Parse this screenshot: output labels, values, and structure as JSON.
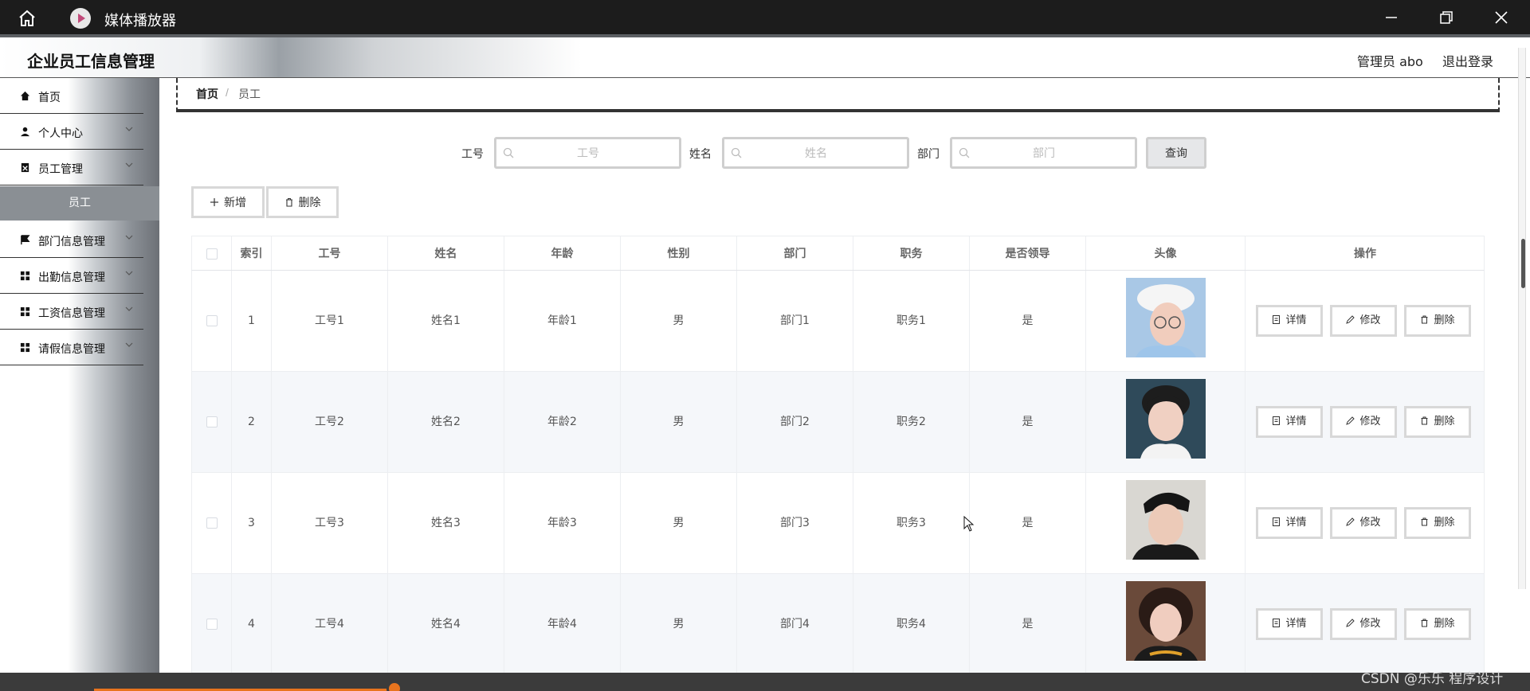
{
  "window": {
    "title": "媒体播放器"
  },
  "app": {
    "brand": "企业员工信息管理",
    "admin_label": "管理员 abo",
    "logout": "退出登录"
  },
  "sidebar": {
    "items": [
      {
        "label": "首页",
        "icon": "home-icon"
      },
      {
        "label": "个人中心",
        "icon": "user-icon"
      },
      {
        "label": "员工管理",
        "icon": "clipboard-icon"
      },
      {
        "label": "部门信息管理",
        "icon": "flag-icon"
      },
      {
        "label": "出勤信息管理",
        "icon": "grid-icon"
      },
      {
        "label": "工资信息管理",
        "icon": "grid-icon"
      },
      {
        "label": "请假信息管理",
        "icon": "grid-icon"
      }
    ],
    "active_sub": "员工"
  },
  "breadcrumb": {
    "home": "首页",
    "separator": "/",
    "current": "员工"
  },
  "search": {
    "id_label": "工号",
    "id_placeholder": "工号",
    "name_label": "姓名",
    "name_placeholder": "姓名",
    "dept_label": "部门",
    "dept_placeholder": "部门",
    "query_button": "查询"
  },
  "actions": {
    "add": "新增",
    "delete": "删除"
  },
  "table": {
    "columns": [
      "索引",
      "工号",
      "姓名",
      "年龄",
      "性别",
      "部门",
      "职务",
      "是否领导",
      "头像",
      "操作"
    ],
    "rows": [
      {
        "index": "1",
        "id": "工号1",
        "name": "姓名1",
        "age": "年龄1",
        "gender": "男",
        "dept": "部门1",
        "position": "职务1",
        "leader": "是"
      },
      {
        "index": "2",
        "id": "工号2",
        "name": "姓名2",
        "age": "年龄2",
        "gender": "男",
        "dept": "部门2",
        "position": "职务2",
        "leader": "是"
      },
      {
        "index": "3",
        "id": "工号3",
        "name": "姓名3",
        "age": "年龄3",
        "gender": "男",
        "dept": "部门3",
        "position": "职务3",
        "leader": "是"
      },
      {
        "index": "4",
        "id": "工号4",
        "name": "姓名4",
        "age": "年龄4",
        "gender": "男",
        "dept": "部门4",
        "position": "职务4",
        "leader": "是"
      }
    ],
    "row_actions": {
      "detail": "详情",
      "edit": "修改",
      "delete": "删除"
    }
  },
  "player": {
    "watermark": "CSDN @乐乐 程序设计",
    "accent": "#e8741e"
  }
}
